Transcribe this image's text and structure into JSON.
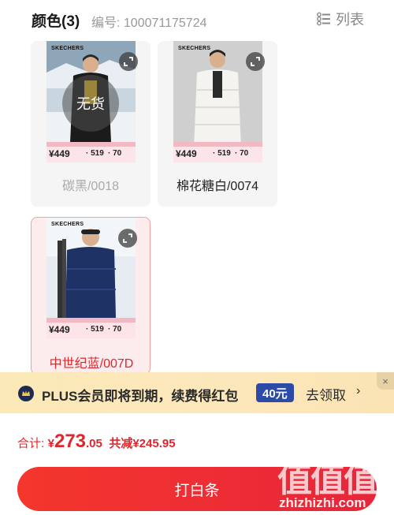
{
  "header": {
    "title": "颜色(3)",
    "sku": "编号: 100071175724",
    "list_label": "列表"
  },
  "variants": [
    {
      "brand": "SKECHERS",
      "label": "碳黑/0018",
      "status": "无货",
      "selected": false,
      "strip": {
        "price": "¥449",
        "mid": "· 519",
        "right": "· 70"
      }
    },
    {
      "brand": "SKECHERS",
      "label": "棉花糖白/0074",
      "selected": false,
      "strip": {
        "price": "¥449",
        "mid": "· 519",
        "right": "· 70"
      }
    },
    {
      "brand": "SKECHERS",
      "label": "中世纪蓝/007D",
      "selected": true,
      "strip": {
        "price": "¥449",
        "mid": "· 519",
        "right": "· 70"
      }
    }
  ],
  "plus_banner": {
    "text": "PLUS会员即将到期，续费得红包",
    "badge": "40元",
    "action": "去领取",
    "arrow": "›",
    "close": "×"
  },
  "footer": {
    "total_label": "合计:",
    "currency": "¥",
    "amount_int": "273",
    "amount_dec": ".05",
    "discount": "共减¥245.95",
    "cta": "打白条"
  },
  "watermark": {
    "glyphs": "值值值",
    "url": "zhizhizhi.com"
  },
  "colors": {
    "accent": "#e0262d",
    "cta_gradient_start": "#f4362c",
    "cta_gradient_end": "#e8253b",
    "plus_badge": "#2c4aa8",
    "plus_banner_bg": "#fce7bb"
  },
  "icons": {
    "list": "list-icon",
    "zoom": "expand-icon",
    "plus_logo": "plus-member-icon",
    "close": "close-icon",
    "arrow": "chevron-right-icon"
  }
}
